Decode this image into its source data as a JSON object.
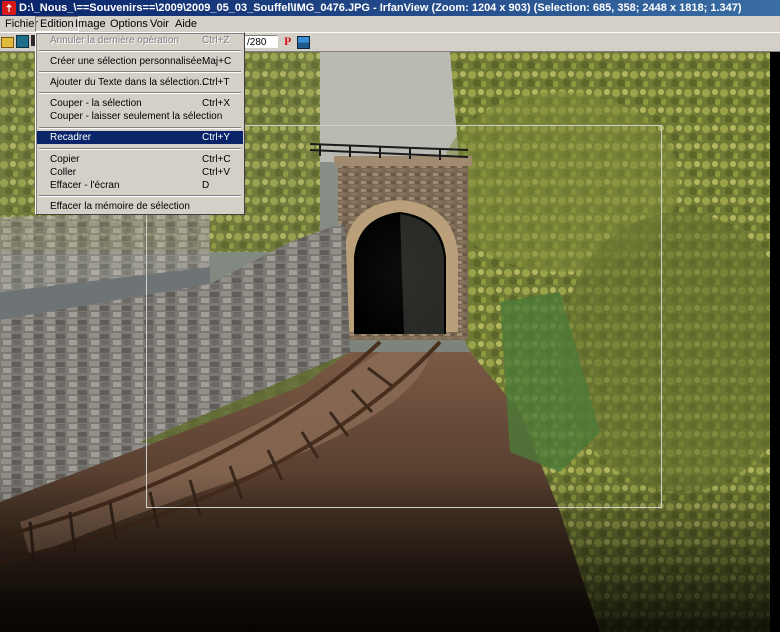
{
  "window": {
    "title": "D:\\_Nous_\\==Souvenirs==\\2009\\2009_05_03_Souffel\\IMG_0476.JPG - IrfanView (Zoom: 1204 x 903) (Selection: 685, 358; 2448 x 1818; 1.347)"
  },
  "menubar": {
    "items": [
      "Fichier",
      "Edition",
      "Image",
      "Options",
      "Voir",
      "Aide"
    ]
  },
  "toolbar": {
    "page_field": "/280",
    "p_label": "P"
  },
  "edition_menu": {
    "items": [
      {
        "label": "Annuler la dernière opération",
        "shortcut": "Ctrl+Z"
      },
      {
        "label": "Créer une sélection personnalisée...",
        "shortcut": "Maj+C"
      },
      {
        "label": "Ajouter du Texte dans la sélection...",
        "shortcut": "Ctrl+T"
      },
      {
        "label": "Couper - la sélection",
        "shortcut": "Ctrl+X"
      },
      {
        "label": "Couper - laisser seulement la sélection",
        "shortcut": ""
      },
      {
        "label": "Recadrer",
        "shortcut": "Ctrl+Y"
      },
      {
        "label": "Copier",
        "shortcut": "Ctrl+C"
      },
      {
        "label": "Coller",
        "shortcut": "Ctrl+V"
      },
      {
        "label": "Effacer - l'écran",
        "shortcut": "D"
      },
      {
        "label": "Effacer la mémoire de sélection",
        "shortcut": ""
      }
    ]
  },
  "colors": {
    "menu_highlight": "#0a246a",
    "titlebar": "#0a246a",
    "face": "#d4d0c8"
  }
}
